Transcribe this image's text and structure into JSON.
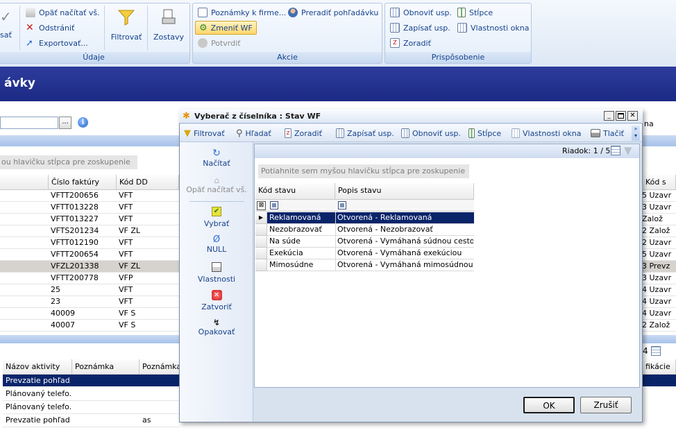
{
  "ribbon": {
    "groups": {
      "udaje": {
        "label": "Údaje",
        "partial": "sať",
        "items": [
          "Opäť načítať vš.",
          "Odstrániť",
          "Exportovať..."
        ],
        "filter": "Filtrovať",
        "reports": "Zostavy"
      },
      "akcie": {
        "label": "Akcie",
        "items": [
          "Poznámky k firme...",
          "Zmeniť WF",
          "Potvrdiť",
          "Preradiť pohľadávku"
        ]
      },
      "prisp": {
        "label": "Prispôsobenie",
        "items": [
          "Obnoviť usp.",
          "Zapísať usp.",
          "Zoradiť",
          "Stĺpce",
          "Vlastnosti okna"
        ]
      }
    }
  },
  "page": {
    "title": "ávky",
    "group_hint": "ou hlavičku stĺpca pre zoskupenie",
    "browse_btn": "...",
    "right_partial": "na"
  },
  "main_grid": {
    "headers": [
      "Číslo faktúry",
      "Kód DD",
      "Kód s"
    ],
    "rows": [
      {
        "invoice": "VFTT200656",
        "code": "VFT",
        "status": "5 Uzavr"
      },
      {
        "invoice": "VFTT013228",
        "code": "VFT",
        "status": "3 Uzavr"
      },
      {
        "invoice": "VFTT013227",
        "code": "VFT",
        "status": "Založ"
      },
      {
        "invoice": "VFTS201234",
        "code": "VF ZL",
        "status": "2 Založ"
      },
      {
        "invoice": "VFTT012190",
        "code": "VFT",
        "status": "2 Uzavr"
      },
      {
        "invoice": "VFTT200654",
        "code": "VFT",
        "status": "5 Uzavr"
      },
      {
        "invoice": "VFZL201338",
        "code": "VF ZL",
        "status": "3 Prevz"
      },
      {
        "invoice": "VFTT200778",
        "code": "VFP",
        "status": "3 Uzavr"
      },
      {
        "invoice": "25",
        "code": "VFT",
        "status": "4 Uzavr"
      },
      {
        "invoice": "23",
        "code": "VFT",
        "status": "4 Uzavr"
      },
      {
        "invoice": "40009",
        "code": "VF S",
        "status": "4 Uzavr"
      },
      {
        "invoice": "40007",
        "code": "VF S",
        "status": "2 Založ"
      }
    ],
    "pager_partial": "4"
  },
  "activity_grid": {
    "headers": [
      "Názov aktivity",
      "Poznámka",
      "Poznámka",
      "fikácie"
    ],
    "rows": [
      {
        "name": "Prevzatie pohľad...",
        "note": "",
        "note2": ""
      },
      {
        "name": "Plánovaný telefo...",
        "note": "",
        "note2": ""
      },
      {
        "name": "Plánovaný telefo...",
        "note": "",
        "note2": ""
      },
      {
        "name": "Prevzatie pohľad...",
        "note": "",
        "note2": "as"
      }
    ]
  },
  "dialog": {
    "title": "Vyberač z číselníka : Stav WF",
    "toolbar": [
      "Filtrovať",
      "Hľadať",
      "Zoradiť",
      "Zapísať usp.",
      "Obnoviť usp.",
      "Stĺpce",
      "Vlastnosti okna",
      "Tlačiť"
    ],
    "side": [
      "Načítať",
      "Opäť načítať vš.",
      "Vybrať",
      "NULL",
      "Vlastnosti",
      "Zatvoriť",
      "Opakovať"
    ],
    "row_info": "Riadok: 1 / 5",
    "group_hint": "Potiahnite sem myšou hlavičku stĺpca pre zoskupenie",
    "columns": [
      "Kód stavu",
      "Popis stavu"
    ],
    "rows": [
      {
        "code": "Reklamovaná",
        "desc": "Otvorená - Reklamovaná"
      },
      {
        "code": "Nezobrazovať",
        "desc": "Otvorená - Nezobrazovať"
      },
      {
        "code": "Na súde",
        "desc": "Otvorená - Vymáhaná súdnou cestou"
      },
      {
        "code": "Exekúcia",
        "desc": "Otvorená - Vymáhaná exekúciou"
      },
      {
        "code": "Mimosúdne",
        "desc": "Otvorená  - Vymáhaná  mimosúdnou  c..."
      }
    ],
    "ok": "OK",
    "cancel": "Zrušiť"
  }
}
